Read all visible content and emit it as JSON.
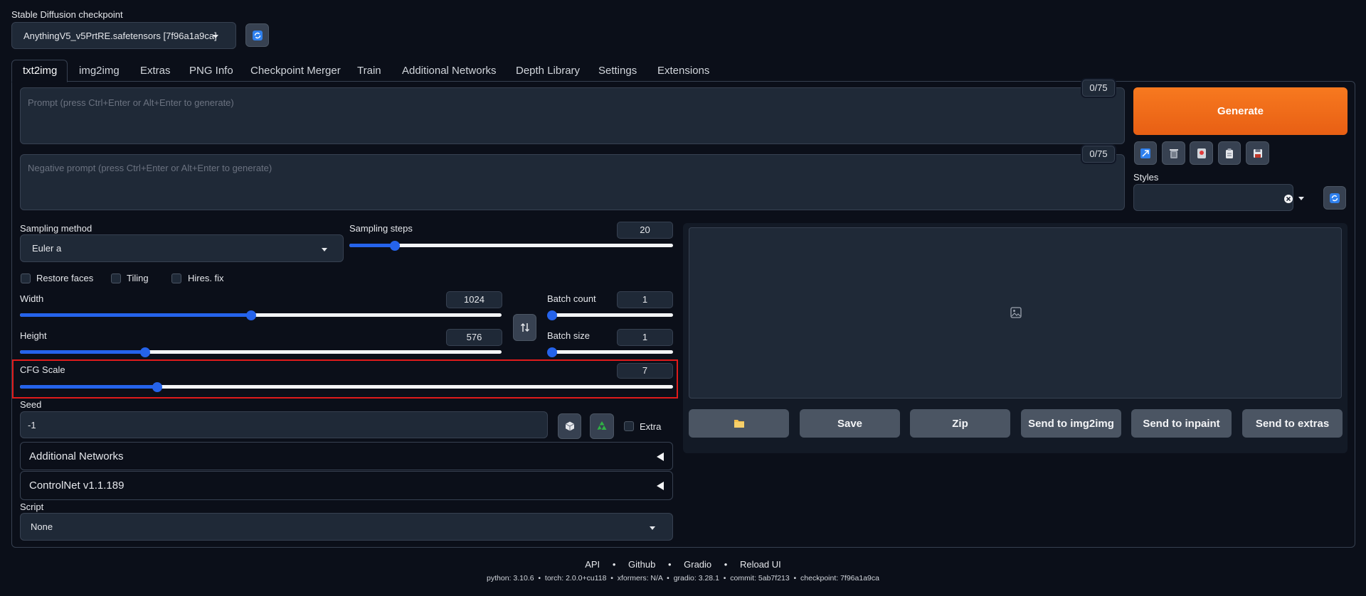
{
  "checkpoint": {
    "label": "Stable Diffusion checkpoint",
    "value": "AnythingV5_v5PrtRE.safetensors [7f96a1a9ca]"
  },
  "tabs": [
    "txt2img",
    "img2img",
    "Extras",
    "PNG Info",
    "Checkpoint Merger",
    "Train",
    "Additional Networks",
    "Depth Library",
    "Settings",
    "Extensions"
  ],
  "active_tab": "txt2img",
  "prompt": {
    "placeholder": "Prompt (press Ctrl+Enter or Alt+Enter to generate)",
    "counter": "0/75"
  },
  "negative_prompt": {
    "placeholder": "Negative prompt (press Ctrl+Enter or Alt+Enter to generate)",
    "counter": "0/75"
  },
  "generate_label": "Generate",
  "styles_label": "Styles",
  "sampling": {
    "method_label": "Sampling method",
    "method_value": "Euler a",
    "steps_label": "Sampling steps",
    "steps_value": "20",
    "steps_fraction": 0.14
  },
  "checkboxes": {
    "restore_faces": "Restore faces",
    "tiling": "Tiling",
    "hires_fix": "Hires. fix"
  },
  "width": {
    "label": "Width",
    "value": "1024",
    "fraction": 0.48
  },
  "height": {
    "label": "Height",
    "value": "576",
    "fraction": 0.26
  },
  "batch_count": {
    "label": "Batch count",
    "value": "1",
    "fraction": 0.0
  },
  "batch_size": {
    "label": "Batch size",
    "value": "1",
    "fraction": 0.0
  },
  "cfg": {
    "label": "CFG Scale",
    "value": "7",
    "fraction": 0.21
  },
  "seed": {
    "label": "Seed",
    "value": "-1",
    "extra_label": "Extra"
  },
  "accordions": {
    "additional_networks": "Additional Networks",
    "controlnet": "ControlNet v1.1.189"
  },
  "script": {
    "label": "Script",
    "value": "None"
  },
  "output_buttons": {
    "save": "Save",
    "zip": "Zip",
    "send_img2img": "Send to img2img",
    "send_inpaint": "Send to inpaint",
    "send_extras": "Send to extras"
  },
  "footer": {
    "links": [
      "API",
      "Github",
      "Gradio",
      "Reload UI"
    ],
    "separator": "•",
    "versions": "python: 3.10.6  •  torch: 2.0.0+cu118  •  xformers: N/A  •  gradio: 3.28.1  •  commit: 5ab7f213  •  checkpoint: 7f96a1a9ca"
  },
  "colors": {
    "accent": "#2563eb",
    "generate": "#f26c1a",
    "highlight": "#e01b1b",
    "background": "#0b0f19"
  }
}
